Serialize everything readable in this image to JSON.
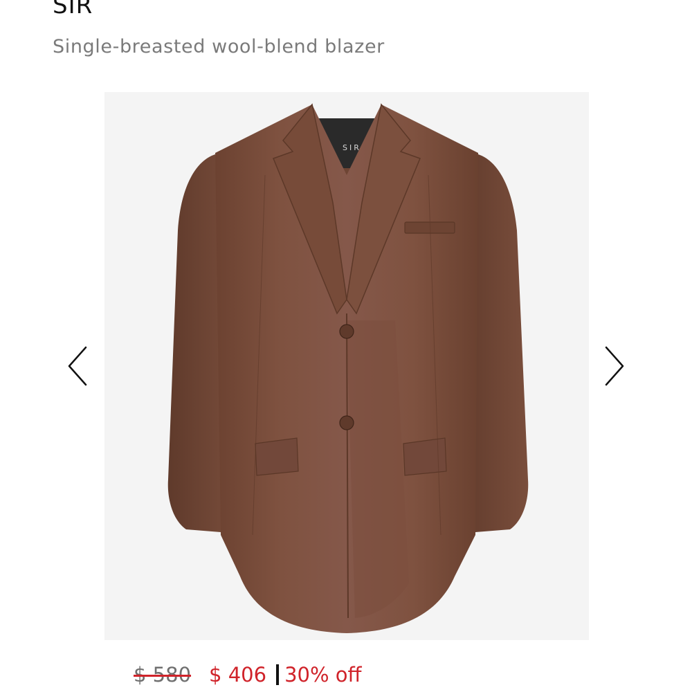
{
  "product": {
    "brand": "SIR",
    "name": "Single-breasted wool-blend blazer",
    "image_label": "SIR.",
    "image_alt": "Brown single-breasted wool-blend blazer"
  },
  "pricing": {
    "original": "$ 580",
    "sale": "$ 406",
    "discount": "30% off"
  },
  "carousel": {
    "prev_icon": "chevron-left-icon",
    "next_icon": "chevron-right-icon"
  },
  "colors": {
    "blazer": "#7d4f3c",
    "sale_red": "#d0232a",
    "image_background": "#f4f4f4"
  }
}
